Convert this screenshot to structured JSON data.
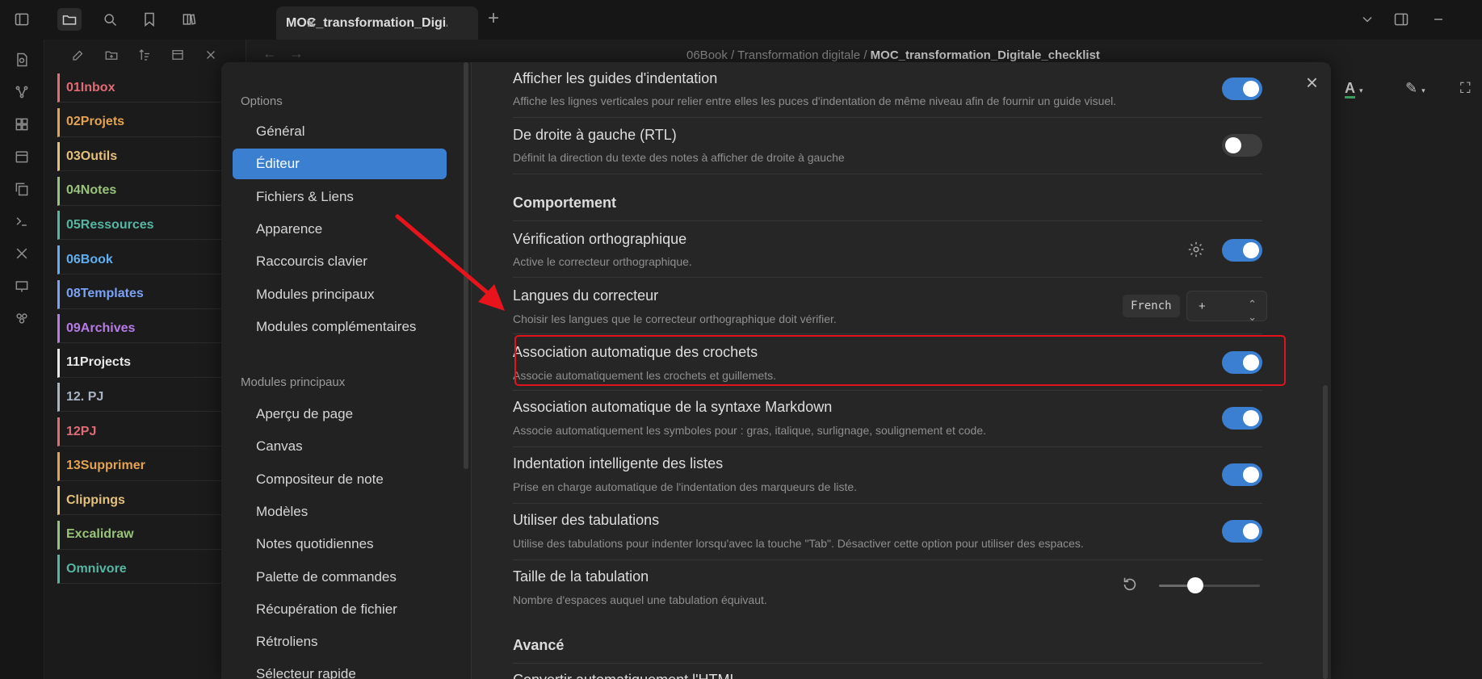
{
  "tab": {
    "title": "MOC_transformation_Digi...",
    "close": "×"
  },
  "new_tab": "+",
  "breadcrumb": {
    "part1": "06Book",
    "sep": "/",
    "part2": "Transformation digitale",
    "current": "MOC_transformation_Digitale_checklist"
  },
  "explorer": {
    "folders": [
      {
        "label": "01Inbox",
        "color": "#e06c75"
      },
      {
        "label": "02Projets",
        "color": "#e5a34f"
      },
      {
        "label": "03Outils",
        "color": "#e5c07b"
      },
      {
        "label": "04Notes",
        "color": "#98c379"
      },
      {
        "label": "05Ressources",
        "color": "#56b6a2"
      },
      {
        "label": "06Book",
        "color": "#61afef"
      },
      {
        "label": "08Templates",
        "color": "#7aa2f7"
      },
      {
        "label": "09Archives",
        "color": "#b67be6"
      },
      {
        "label": "11Projects",
        "color": "#e8e8e8"
      },
      {
        "label": "12. PJ",
        "color": "#a9b4c2"
      },
      {
        "label": "12PJ",
        "color": "#e06c75"
      },
      {
        "label": "13Supprimer",
        "color": "#e5a34f"
      },
      {
        "label": "Clippings",
        "color": "#e5c07b"
      },
      {
        "label": "Excalidraw",
        "color": "#98c379"
      },
      {
        "label": "Omnivore",
        "color": "#56b6a2"
      }
    ]
  },
  "sidebar": {
    "options_heading": "Options",
    "options": [
      "Général",
      "Éditeur",
      "Fichiers & Liens",
      "Apparence",
      "Raccourcis clavier",
      "Modules principaux",
      "Modules complémentaires"
    ],
    "active_index": 1,
    "plugins_heading": "Modules principaux",
    "plugins": [
      "Aperçu de page",
      "Canvas",
      "Compositeur de note",
      "Modèles",
      "Notes quotidiennes",
      "Palette de commandes",
      "Récupération de fichier",
      "Rétroliens",
      "Sélecteur rapide"
    ]
  },
  "settings": {
    "indent_guides": {
      "name": "Afficher les guides d'indentation",
      "desc": "Affiche les lignes verticales pour relier entre elles les puces d'indentation de même niveau afin de fournir un guide visuel.",
      "on": true
    },
    "rtl": {
      "name": "De droite à gauche (RTL)",
      "desc": "Définit la direction du texte des notes à afficher de droite à gauche",
      "on": false
    },
    "behaviour_heading": "Comportement",
    "spellcheck": {
      "name": "Vérification orthographique",
      "desc": "Active le correcteur orthographique.",
      "on": true
    },
    "spell_langs": {
      "name": "Langues du correcteur",
      "desc": "Choisir les langues que le correcteur orthographique doit vérifier.",
      "chip": "French",
      "dropdown": "+"
    },
    "auto_brackets": {
      "name": "Association automatique des crochets",
      "desc": "Associe automatiquement les crochets et guillemets.",
      "on": true
    },
    "auto_markdown": {
      "name": "Association automatique de la syntaxe Markdown",
      "desc": "Associe automatiquement les symboles pour : gras, italique, surlignage, soulignement et code.",
      "on": true
    },
    "smart_indent": {
      "name": "Indentation intelligente des listes",
      "desc": "Prise en charge automatique de l'indentation des marqueurs de liste.",
      "on": true
    },
    "use_tabs": {
      "name": "Utiliser des tabulations",
      "desc": "Utilise des tabulations pour indenter lorsqu'avec la touche \"Tab\". Désactiver cette option pour utiliser des espaces.",
      "on": true
    },
    "tab_size": {
      "name": "Taille de la tabulation",
      "desc": "Nombre d'espaces auquel une tabulation équivaut.",
      "slider_fraction": 0.36
    },
    "advanced_heading": "Avancé",
    "partial_next": {
      "name": "Convertir automatiquement l'HTML"
    }
  },
  "modal_close": "×",
  "colors": {
    "accent": "#3a7fd0",
    "highlight": "#e0141e",
    "arrow": "#e8141c"
  }
}
